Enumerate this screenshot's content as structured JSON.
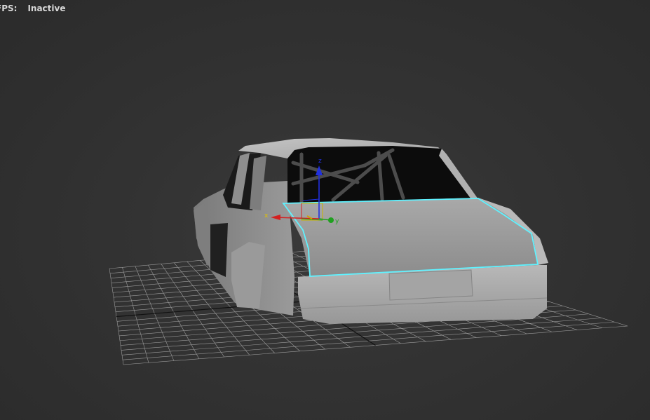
{
  "viewport": {
    "stats": {
      "label": "FPS:",
      "value": "Inactive"
    },
    "gizmo": {
      "x_label": "x",
      "y_label": "y",
      "z_label": "z",
      "x_color": "#d42020",
      "y_color": "#20a020",
      "z_color": "#2030e0"
    },
    "selection_color": "#5ff2ff",
    "background_color": "#333333"
  }
}
